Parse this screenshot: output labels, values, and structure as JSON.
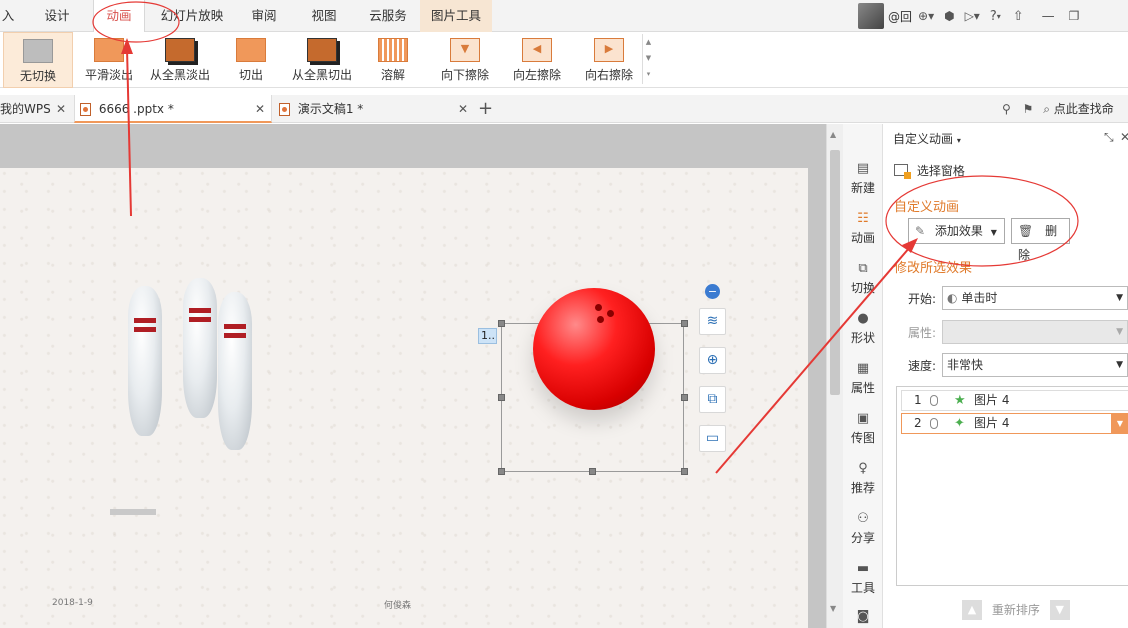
{
  "menubar": {
    "items": [
      {
        "label": "入"
      },
      {
        "label": "设计"
      },
      {
        "label": "动画"
      },
      {
        "label": "幻灯片放映"
      },
      {
        "label": "审阅"
      },
      {
        "label": "视图"
      },
      {
        "label": "云服务"
      },
      {
        "label": "图片工具"
      }
    ],
    "user_label": "@回",
    "help_label": "?"
  },
  "ribbon": {
    "transitions": [
      {
        "label": "无切换",
        "icon": "no-transition-icon"
      },
      {
        "label": "平滑淡出",
        "icon": "fade-smooth-icon"
      },
      {
        "label": "从全黑淡出",
        "icon": "fade-through-black-icon"
      },
      {
        "label": "切出",
        "icon": "cut-icon"
      },
      {
        "label": "从全黑切出",
        "icon": "cut-through-black-icon"
      },
      {
        "label": "溶解",
        "icon": "dissolve-icon"
      },
      {
        "label": "向下擦除",
        "icon": "wipe-down-icon"
      },
      {
        "label": "向左擦除",
        "icon": "wipe-left-icon"
      },
      {
        "label": "向右擦除",
        "icon": "wipe-right-icon"
      }
    ]
  },
  "tabs": {
    "items": [
      {
        "label": "我的WPS"
      },
      {
        "label": "6666 .pptx *"
      },
      {
        "label": "演示文稿1 *"
      }
    ],
    "add_label": "+",
    "find_label": "点此查找命"
  },
  "slide": {
    "anim_marker": "1..",
    "footer_date": "2018-1-9",
    "footer_author": "何俊森"
  },
  "sidebar": {
    "items": [
      {
        "label": "新建",
        "icon": "new-doc-icon"
      },
      {
        "label": "动画",
        "icon": "animation-icon"
      },
      {
        "label": "切换",
        "icon": "transition-icon"
      },
      {
        "label": "形状",
        "icon": "shape-icon"
      },
      {
        "label": "属性",
        "icon": "properties-icon"
      },
      {
        "label": "传图",
        "icon": "upload-image-icon"
      },
      {
        "label": "推荐",
        "icon": "recommend-icon"
      },
      {
        "label": "分享",
        "icon": "share-icon"
      },
      {
        "label": "工具",
        "icon": "toolbox-icon"
      }
    ]
  },
  "pane": {
    "title": "自定义动画",
    "selection_pane": "选择窗格",
    "section_custom": "自定义动画",
    "add_effect": "添加效果",
    "delete": "删除",
    "section_modify": "修改所选效果",
    "start_label": "开始:",
    "start_value": "单击时",
    "property_label": "属性:",
    "speed_label": "速度:",
    "speed_value": "非常快",
    "list": [
      {
        "num": "1",
        "name": "图片 4"
      },
      {
        "num": "2",
        "name": "图片 4"
      }
    ],
    "reorder": "重新排序"
  },
  "colors": {
    "accent_orange": "#f0985a",
    "annotation_red": "#e53935",
    "section_orange": "#e07a2a"
  }
}
